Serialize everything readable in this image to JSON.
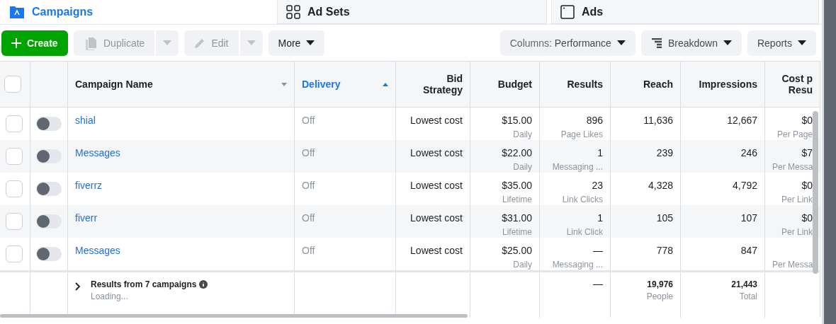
{
  "tabs": [
    {
      "label": "Campaigns",
      "selected": true,
      "kind": "folder"
    },
    {
      "label": "Ad Sets",
      "selected": false,
      "kind": "grid"
    },
    {
      "label": "Ads",
      "selected": false,
      "kind": "window"
    }
  ],
  "toolbar": {
    "left": [
      {
        "label": "Create",
        "kind": "primary"
      },
      {
        "label": "Duplicate",
        "kind": "split",
        "disabled": true
      },
      {
        "label": "Edit",
        "kind": "split",
        "disabled": true
      },
      {
        "label": "More",
        "kind": "menu",
        "disabled": false
      }
    ],
    "right": [
      {
        "label": "Performance",
        "prefix": "Columns: "
      },
      {
        "label": "Breakdown"
      },
      {
        "label": "Reports"
      }
    ]
  },
  "table": {
    "columns": [
      {
        "kind": "check",
        "checked": false
      },
      {
        "kind": "toggle"
      },
      {
        "label": "Campaign Name",
        "kind": "name",
        "sorted": false
      },
      {
        "label": "Delivery",
        "kind": "name",
        "sorted": true
      },
      {
        "label": "Bid\nStrategy",
        "kind": "num"
      },
      {
        "label": "Budget",
        "kind": "num"
      },
      {
        "label": "Results",
        "kind": "num"
      },
      {
        "label": "Reach",
        "kind": "num"
      },
      {
        "label": "Impressions",
        "kind": "num"
      },
      {
        "label": "Cost p\nResu",
        "kind": "num"
      }
    ],
    "rows": [
      {
        "checked": false,
        "on": false,
        "name": "shial",
        "delivery": "Off",
        "bid": "Lowest cost",
        "budget": "$15.00",
        "budget_type": "Daily",
        "results": "896",
        "result_type": "Page Likes",
        "reach": "11,636",
        "impressions": "12,667",
        "cost": "$0",
        "cost_type": "Per Page"
      },
      {
        "checked": false,
        "on": false,
        "name": "Messages",
        "delivery": "Off",
        "bid": "Lowest cost",
        "budget": "$22.00",
        "budget_type": "Daily",
        "results": "1",
        "result_type": "Messaging ...",
        "reach": "239",
        "impressions": "246",
        "cost": "$7",
        "cost_type": "Per Messa"
      },
      {
        "checked": false,
        "on": false,
        "name": "fiverrz",
        "delivery": "Off",
        "bid": "Lowest cost",
        "budget": "$35.00",
        "budget_type": "Lifetime",
        "results": "23",
        "result_type": "Link Clicks",
        "reach": "4,328",
        "impressions": "4,792",
        "cost": "$0",
        "cost_type": "Per Link"
      },
      {
        "checked": false,
        "on": false,
        "name": "fiverr",
        "delivery": "Off",
        "bid": "Lowest cost",
        "budget": "$31.00",
        "budget_type": "Lifetime",
        "results": "1",
        "result_type": "Link Click",
        "reach": "105",
        "impressions": "107",
        "cost": "$0",
        "cost_type": "Per Link"
      },
      {
        "checked": false,
        "on": false,
        "name": "Messages",
        "delivery": "Off",
        "bid": "Lowest cost",
        "budget": "$25.00",
        "budget_type": "Daily",
        "results": "—",
        "result_type": "Messaging ...",
        "reach": "778",
        "impressions": "847",
        "cost_type": "Per Messa"
      }
    ],
    "summary": {
      "title": "Results from 7 campaigns",
      "status": "Loading...",
      "results": "—",
      "reach": "19,976",
      "reach_type": "People",
      "impressions": "21,443",
      "impressions_type": "Total"
    }
  }
}
